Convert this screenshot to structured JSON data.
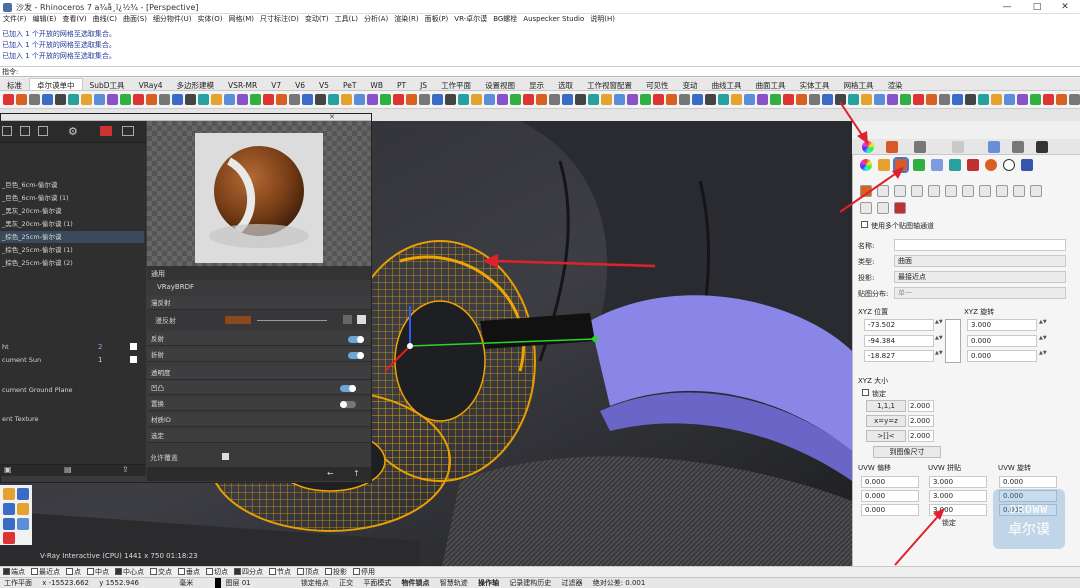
{
  "window": {
    "title": "沙发 - Rhinoceros 7 a¾å¸ï¿½¾ - [Perspective]",
    "min": "—",
    "max": "□",
    "close": "✕"
  },
  "menu": [
    "文件(F)",
    "编辑(E)",
    "查看(V)",
    "曲线(C)",
    "曲面(S)",
    "细分物件(U)",
    "实体(O)",
    "网格(M)",
    "尺寸标注(D)",
    "变动(T)",
    "工具(L)",
    "分析(A)",
    "渲染(R)",
    "面板(P)",
    "VR-卓尔谟",
    "BG螺栓",
    "Auspecker Studio",
    "说明(H)"
  ],
  "command_history": [
    "已加入 1 个开放的网格至选取集合。",
    "已加入 1 个开放的网格至选取集合。",
    "已加入 1 个开放的网格至选取集合。"
  ],
  "command_prompt": "指令:",
  "tabs": [
    "标准",
    "卓尔谟单中",
    "SubD工具",
    "VRay4",
    "多边形建模",
    "VSR-MR",
    "V7",
    "V6",
    "V5",
    "PeT",
    "WB",
    "PT",
    "JS",
    "工作平面",
    "设置视图",
    "显示",
    "选取",
    "工作视窗配置",
    "可见性",
    "变动",
    "曲线工具",
    "曲面工具",
    "实体工具",
    "网格工具",
    "渲染"
  ],
  "active_tab": "卓尔谟单中",
  "material_panel": {
    "left_items": [
      "_巨色_6cm-偷尔谟",
      "_巨色_6cm-偷尔谟 (1)",
      "_黑灰_20cm-偷尔谟",
      "_黑灰_20cm-偷尔谟 (1)",
      "_棕色_25cm-偷尔谟",
      "_棕色_25cm-偷尔谟 (1)",
      "_棕色_25cm-偷尔谟 (2)"
    ],
    "selected_index": 4,
    "light_items": [
      {
        "label": "ht",
        "count": "2"
      },
      {
        "label": "cument Sun",
        "count": "1"
      }
    ],
    "env_items": [
      "cument Ground Plane",
      "ent Texture"
    ],
    "header_label": "通用",
    "material_type": "VRayBRDF",
    "sections": [
      "漫反射",
      "反射",
      "折射",
      "透明度",
      "凹凸",
      "置换",
      "材质ID",
      "选定"
    ],
    "diffuse_label": "漫反射",
    "allow_override": "允许覆盖"
  },
  "viewport": {
    "status": "V-Ray Interactive (CPU)   1441 x 750   01:18:23"
  },
  "right_panel": {
    "name_label": "名称:",
    "type_label": "类型:",
    "type_value": "曲面",
    "proj_label": "投影:",
    "proj_value": "最接近点",
    "dist_label": "贴图分布:",
    "dist_value": "单一",
    "multi_channel": "使用多个贴图轴通道",
    "pos_label": "XYZ 位置",
    "rot_label": "XYZ 旋转",
    "pos": [
      "-73.502",
      "-94.384",
      "-18.827"
    ],
    "rot": [
      "3.000",
      "0.000",
      "0.000"
    ],
    "size_label": "XYZ 大小",
    "lock_label": "锁定",
    "size_btns": [
      "1,1,1",
      "x=y=z",
      ">[]<"
    ],
    "size_vals": [
      "2.000",
      "2.000",
      "2.000"
    ],
    "fit_btn": "到图像尺寸",
    "uvw_offset_label": "UVW 偏移",
    "uvw_repeat_label": "UVW 拼贴",
    "uvw_rot_label": "UVW 旋转",
    "uvw_offset": [
      "0.000",
      "0.000",
      "0.000"
    ],
    "uvw_repeat": [
      "3.000",
      "3.000",
      "3.000"
    ],
    "uvw_rot": [
      "0.000",
      "0.000",
      "0.000"
    ],
    "uvw_lock": "锁定"
  },
  "osnap": [
    "端点",
    "最近点",
    "点",
    "中点",
    "中心点",
    "交点",
    "垂点",
    "切点",
    "四分点",
    "节点",
    "顶点",
    "投影",
    "停用"
  ],
  "osnap_checked": [
    true,
    false,
    false,
    false,
    true,
    false,
    false,
    false,
    true,
    false,
    false,
    false,
    false
  ],
  "status": {
    "plane": "工作平面",
    "x": "x -15523.662",
    "y": "y 1552.946",
    "unit": "毫米",
    "layer": "图层 01",
    "items": [
      "锁定格点",
      "正交",
      "平面模式",
      "物件锁点",
      "智慧轨迹",
      "操作轴",
      "记录建构历史",
      "过滤器",
      "绝对公差: 0.001"
    ]
  },
  "watermark": {
    "top": "DROWW",
    "bottom": "卓尔谟"
  },
  "colors": {
    "accent": "#3b7bd6",
    "wire": "#f0a400",
    "arrow": "#e0202a",
    "cushion": "#8a86e8"
  }
}
